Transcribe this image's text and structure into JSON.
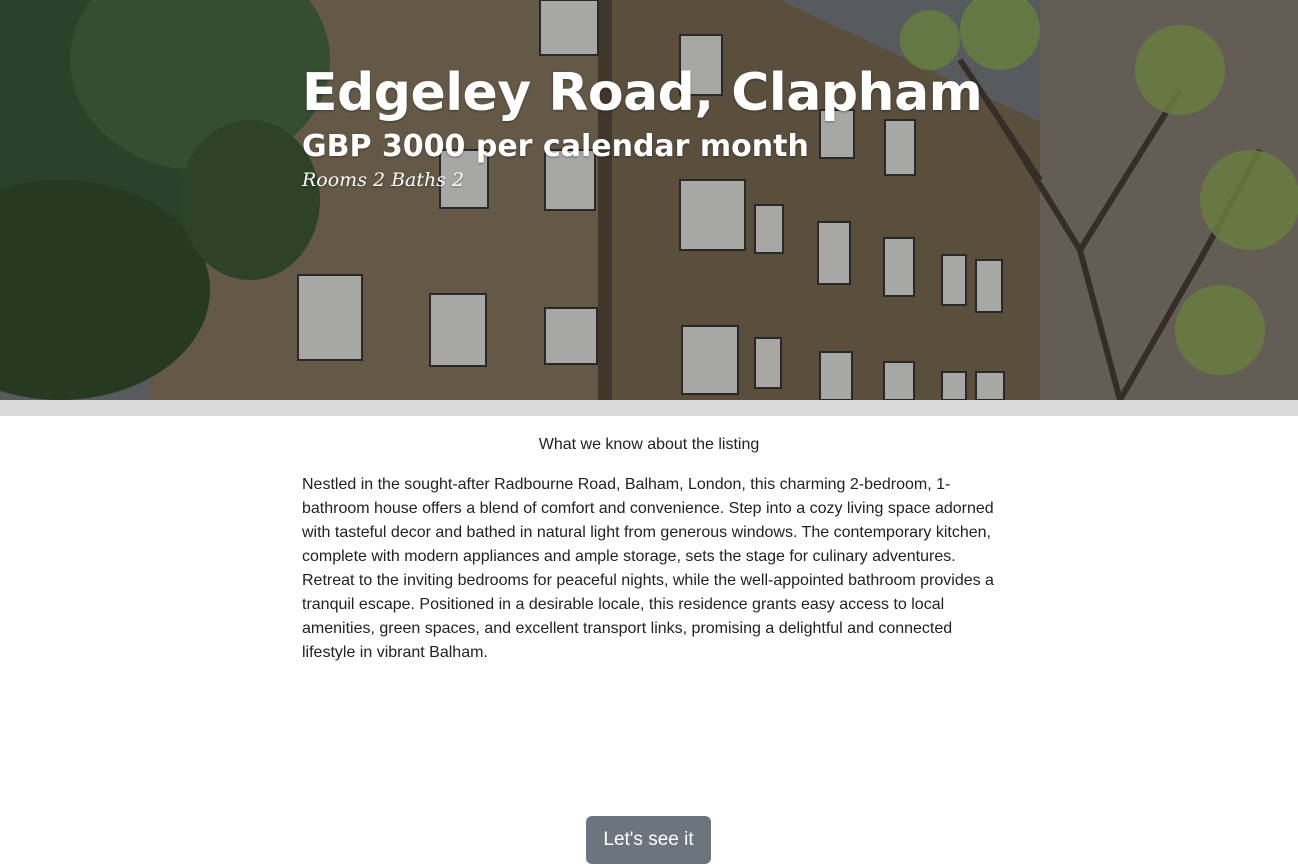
{
  "hero": {
    "title": "Edgeley Road, Clapham",
    "price": "GBP 3000 per calendar month",
    "rooms_label": "Rooms 2",
    "baths_label": "Baths 2"
  },
  "details": {
    "heading": "What we know about the listing",
    "description": "Nestled in the sought-after Radbourne Road, Balham, London, this charming 2-bedroom, 1-bathroom house offers a blend of comfort and convenience. Step into a cozy living space adorned with tasteful decor and bathed in natural light from generous windows. The contemporary kitchen, complete with modern appliances and ample storage, sets the stage for culinary adventures. Retreat to the inviting bedrooms for peaceful nights, while the well-appointed bathroom provides a tranquil escape. Positioned in a desirable locale, this residence grants easy access to local amenities, green spaces, and excellent transport links, promising a delightful and connected lifestyle in vibrant Balham."
  },
  "cta": {
    "label": "Let's see it"
  },
  "colors": {
    "button_bg": "#6c757d",
    "divider": "#dadada",
    "hero_text": "#ffffff"
  }
}
